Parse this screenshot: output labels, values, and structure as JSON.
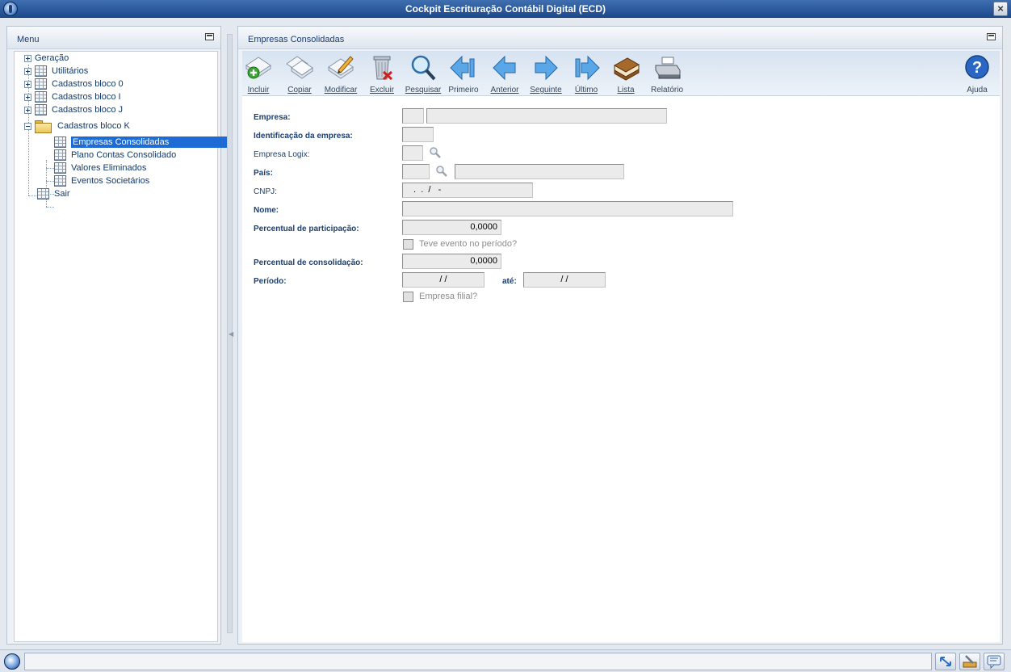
{
  "window": {
    "title": "Cockpit Escrituração Contábil Digital (ECD)"
  },
  "menu": {
    "title": "Menu",
    "items": [
      {
        "label": "Geração",
        "type": "expander"
      },
      {
        "label": "Utilitários",
        "type": "grid"
      },
      {
        "label": "Cadastros bloco 0",
        "type": "grid"
      },
      {
        "label": "Cadastros bloco I",
        "type": "grid"
      },
      {
        "label": "Cadastros bloco J",
        "type": "grid"
      },
      {
        "label": "Cadastros bloco K",
        "type": "folder-open"
      },
      {
        "label": "Empresas Consolidadas",
        "type": "grid",
        "selected": true
      },
      {
        "label": "Plano Contas Consolidado",
        "type": "grid"
      },
      {
        "label": "Valores Eliminados",
        "type": "grid"
      },
      {
        "label": "Eventos Societários",
        "type": "grid"
      },
      {
        "label": "Sair",
        "type": "grid"
      }
    ]
  },
  "content": {
    "title": "Empresas Consolidadas"
  },
  "toolbar": {
    "incluir": "Incluir",
    "copiar": "Copiar",
    "modificar": "Modificar",
    "excluir": "Excluir",
    "pesquisar": "Pesquisar",
    "primeiro": "Primeiro",
    "anterior": "Anterior",
    "seguinte": "Seguinte",
    "ultimo": "Último",
    "lista": "Lista",
    "relatorio": "Relatório",
    "ajuda": "Ajuda"
  },
  "form": {
    "empresa_label": "Empresa:",
    "identificacao_label": "Identificação da empresa:",
    "empresa_logix_label": "Empresa Logix:",
    "pais_label": "País:",
    "cnpj_label": "CNPJ:",
    "cnpj_value": " .  .  /   -",
    "nome_label": "Nome:",
    "percentual_participacao_label": "Percentual de participação:",
    "percentual_participacao_value": "0,0000",
    "teve_evento_label": "Teve evento no período?",
    "percentual_consolidacao_label": "Percentual de consolidação:",
    "percentual_consolidacao_value": "0,0000",
    "periodo_label": "Período:",
    "periodo_inicio_value": "/ /",
    "ate_label": "até:",
    "periodo_fim_value": "/ /",
    "empresa_filial_label": "Empresa filial?"
  },
  "colors": {
    "title_bar": "#2a5a9c",
    "selection": "#1e6bd6",
    "label_text": "#1c3f70"
  }
}
